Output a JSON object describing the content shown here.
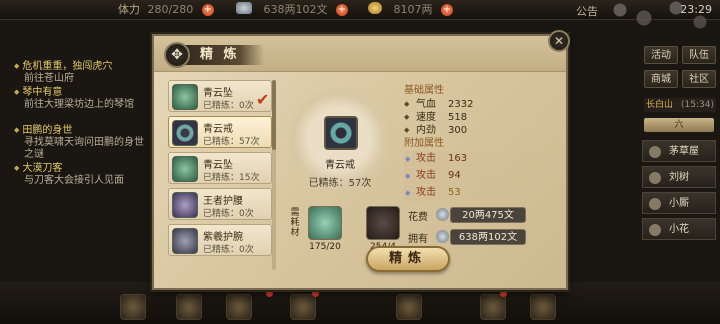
{
  "topbar": {
    "power_label": "体力",
    "power_value": "280/280",
    "silver_value": "638两102文",
    "gold_value": "8107两",
    "notice": "公告",
    "clock": "23:29"
  },
  "quests": [
    {
      "title": "危机重重，独闯虎穴",
      "desc": "前往苍山府"
    },
    {
      "title": "琴中有意",
      "desc": "前往大理梁坊边上的琴馆"
    },
    {
      "title": "田鹏的身世",
      "desc": "寻找莫啸天询问田鹏的身世之谜"
    },
    {
      "title": "大漠刀客",
      "desc": "与刀客大会接引人见面"
    }
  ],
  "sidebar": {
    "buttons": [
      "活动",
      "队伍",
      "商城",
      "社区"
    ],
    "location": "长白山",
    "loc_time": "(15:34)",
    "category": "六",
    "npcs": [
      "茅草屋",
      "刘树",
      "小厮",
      "小花"
    ]
  },
  "dialog": {
    "title": "精 炼",
    "close": "✕",
    "items": [
      {
        "name": "青云坠",
        "stat": "已精练：0次",
        "thumb": "green"
      },
      {
        "name": "青云戒",
        "stat": "已精练：57次",
        "thumb": "ring"
      },
      {
        "name": "青云坠",
        "stat": "已精练：15次",
        "thumb": "green"
      },
      {
        "name": "王者护腰",
        "stat": "已精练：0次",
        "thumb": "armor"
      },
      {
        "name": "紫羲护腕",
        "stat": "已精练：0次",
        "thumb": "wrist"
      }
    ],
    "selected_index": 1,
    "check_mark": "✔",
    "preview": {
      "name": "青云戒",
      "stat": "已精练：57次"
    },
    "base_title": "基础属性",
    "base_attrs": [
      {
        "label": "气血",
        "value": "2332"
      },
      {
        "label": "速度",
        "value": "518"
      },
      {
        "label": "内劲",
        "value": "300"
      }
    ],
    "extra_title": "附加属性",
    "extra_attrs": [
      {
        "label": "攻击",
        "value": "163"
      },
      {
        "label": "攻击",
        "value": "94"
      },
      {
        "label": "攻击",
        "value": "53"
      }
    ],
    "material_tag": "需耗材",
    "materials": [
      {
        "count": "175/20"
      },
      {
        "count": "254/4"
      }
    ],
    "costs": [
      {
        "label": "花费",
        "value": "20两475文"
      },
      {
        "label": "拥有",
        "value": "638两102文"
      }
    ],
    "refine_button": "精炼"
  },
  "colors": {
    "accent_gold": "#e3c96b",
    "dialog_bg": "#d9c7a1",
    "alert_red": "#e0392b"
  }
}
